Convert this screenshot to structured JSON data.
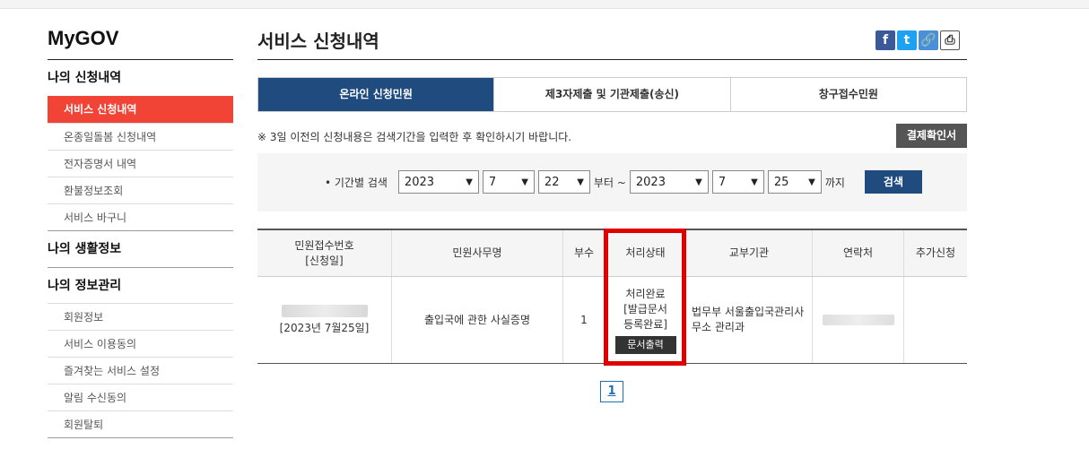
{
  "sidebar": {
    "logo": "MyGOV",
    "sections": [
      {
        "title": "나의 신청내역",
        "items": [
          "서비스 신청내역",
          "온종일돌봄 신청내역",
          "전자증명서 내역",
          "환불정보조회",
          "서비스 바구니"
        ]
      },
      {
        "title": "나의 생활정보"
      },
      {
        "title": "나의 정보관리",
        "items": [
          "회원정보",
          "서비스 이용동의",
          "즐겨찾는 서비스 설정",
          "알림 수신동의",
          "회원탈퇴"
        ]
      }
    ]
  },
  "header": {
    "title": "서비스 신청내역",
    "share_icons": [
      "f",
      "t",
      "🔗",
      "⎙"
    ]
  },
  "tabs": [
    "온라인 신청민원",
    "제3자제출 및 기관제출(송신)",
    "창구접수민원"
  ],
  "notice": "※ 3일 이전의 신청내용은 검색기간을 입력한 후 확인하시기 바랍니다.",
  "confirm_button": "결제확인서",
  "search": {
    "label": "• 기간별 검색",
    "from": {
      "year": "2023",
      "month": "7",
      "day": "22"
    },
    "from_suffix": "부터 ~",
    "to": {
      "year": "2023",
      "month": "7",
      "day": "25"
    },
    "to_suffix": "까지",
    "button": "검색"
  },
  "table": {
    "headers": {
      "receipt_line1": "민원접수번호",
      "receipt_line2": "[신청일]",
      "name": "민원사무명",
      "copies": "부수",
      "status": "처리상태",
      "agency": "교부기관",
      "contact": "연락처",
      "extra": "추가신청"
    },
    "rows": [
      {
        "date": "[2023년 7월25일]",
        "name": "출입국에 관한 사실증명",
        "copies": "1",
        "status_line1": "처리완료",
        "status_line2": "[발급문서",
        "status_line3": "등록완료]",
        "print_button": "문서출력",
        "agency": "법무부 서울출입국관리사무소 관리과"
      }
    ]
  },
  "pagination": {
    "current": "1"
  },
  "colors": {
    "accent_red": "#f14436",
    "navy": "#1f4b7f",
    "highlight": "#e10000"
  }
}
